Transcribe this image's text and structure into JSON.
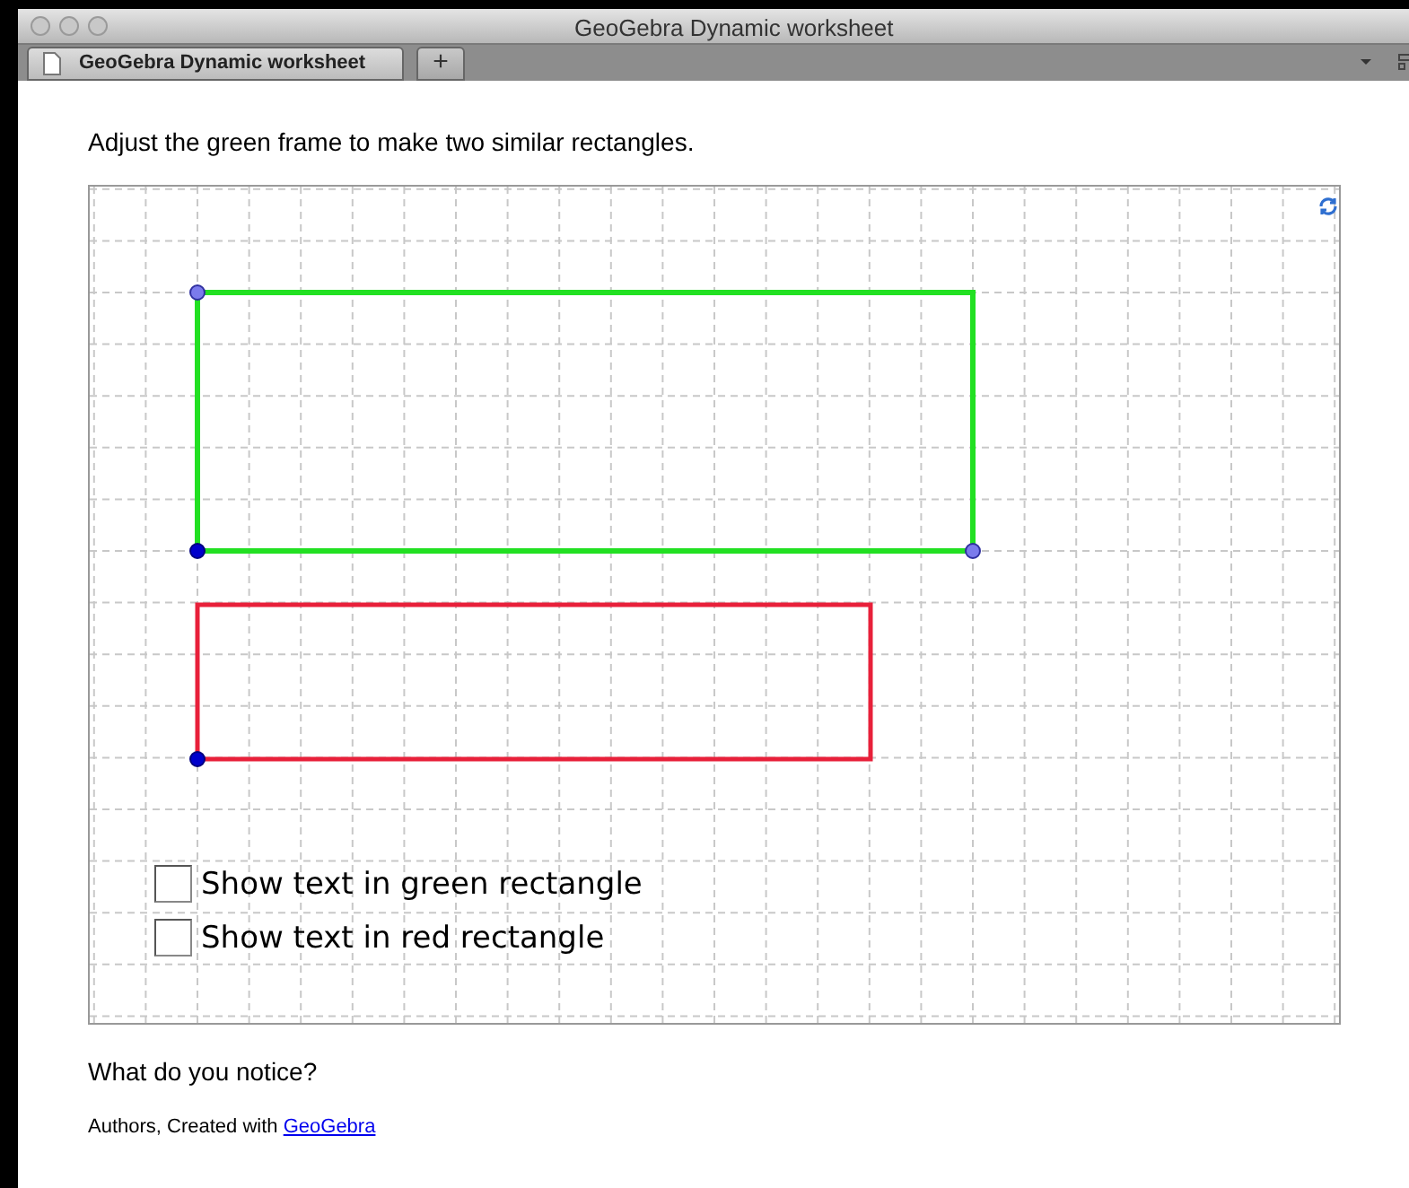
{
  "window": {
    "title": "GeoGebra Dynamic worksheet"
  },
  "tabs": [
    {
      "label": "GeoGebra Dynamic worksheet",
      "selected": true
    }
  ],
  "new_tab": "+",
  "instruction": "Adjust the green frame to make two similar rectangles.",
  "applet": {
    "checkboxes": [
      {
        "label": "Show text in green rectangle",
        "checked": false
      },
      {
        "label": "Show text in red rectangle",
        "checked": false
      }
    ]
  },
  "question": "What do you notice?",
  "footer": {
    "text": "Authors, Created with",
    "link": "GeoGebra"
  }
}
